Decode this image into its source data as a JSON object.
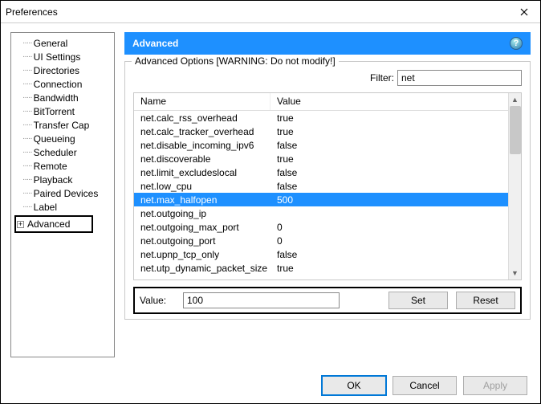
{
  "window": {
    "title": "Preferences"
  },
  "sidebar": {
    "items": [
      {
        "label": "General"
      },
      {
        "label": "UI Settings"
      },
      {
        "label": "Directories"
      },
      {
        "label": "Connection"
      },
      {
        "label": "Bandwidth"
      },
      {
        "label": "BitTorrent"
      },
      {
        "label": "Transfer Cap"
      },
      {
        "label": "Queueing"
      },
      {
        "label": "Scheduler"
      },
      {
        "label": "Remote"
      },
      {
        "label": "Playback"
      },
      {
        "label": "Paired Devices"
      },
      {
        "label": "Label"
      }
    ],
    "selected": "Advanced"
  },
  "panel": {
    "title": "Advanced",
    "group_title": "Advanced Options [WARNING: Do not modify!]",
    "filter_label": "Filter:",
    "filter_value": "net",
    "columns": {
      "name": "Name",
      "value": "Value"
    },
    "rows": [
      {
        "name": "net.calc_rss_overhead",
        "value": "true",
        "sel": false
      },
      {
        "name": "net.calc_tracker_overhead",
        "value": "true",
        "sel": false
      },
      {
        "name": "net.disable_incoming_ipv6",
        "value": "false",
        "sel": false
      },
      {
        "name": "net.discoverable",
        "value": "true",
        "sel": false
      },
      {
        "name": "net.limit_excludeslocal",
        "value": "false",
        "sel": false
      },
      {
        "name": "net.low_cpu",
        "value": "false",
        "sel": false
      },
      {
        "name": "net.max_halfopen",
        "value": "500",
        "sel": true
      },
      {
        "name": "net.outgoing_ip",
        "value": "",
        "sel": false
      },
      {
        "name": "net.outgoing_max_port",
        "value": "0",
        "sel": false
      },
      {
        "name": "net.outgoing_port",
        "value": "0",
        "sel": false
      },
      {
        "name": "net.upnp_tcp_only",
        "value": "false",
        "sel": false
      },
      {
        "name": "net.utp_dynamic_packet_size",
        "value": "true",
        "sel": false
      }
    ],
    "value_label": "Value:",
    "value_input": "100",
    "set_label": "Set",
    "reset_label": "Reset"
  },
  "buttons": {
    "ok": "OK",
    "cancel": "Cancel",
    "apply": "Apply"
  }
}
